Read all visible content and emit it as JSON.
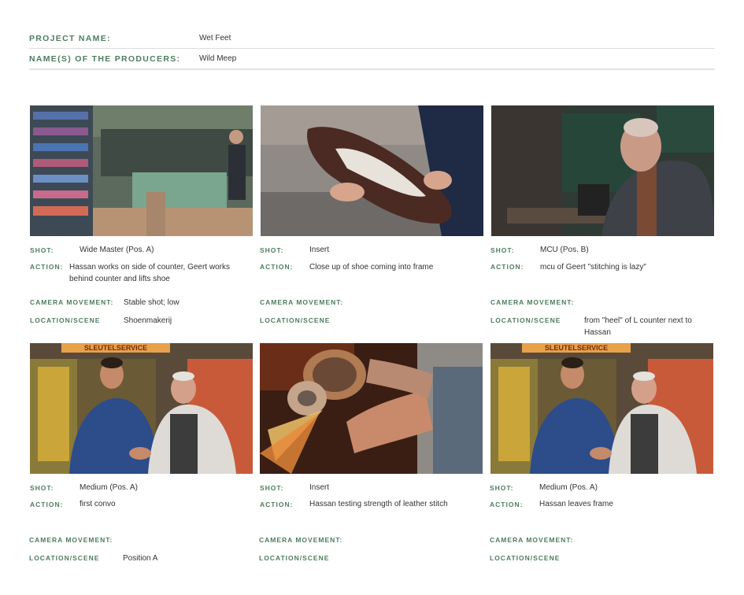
{
  "header": {
    "project_label": "PROJECT NAME:",
    "project_value": "Wet Feet",
    "producers_label": "NAME(S) OF THE PRODUCERS:",
    "producers_value": "Wild Meep"
  },
  "field_labels": {
    "shot": "SHOT:",
    "action": "ACTION:",
    "camera": "CAMERA MOVEMENT:",
    "location": "LOCATION/SCENE"
  },
  "shots": [
    {
      "image": "shoe-shop-interior-photo",
      "shot": "Wide Master (Pos. A)",
      "action": "Hassan works on side of counter, Geert works behind counter and lifts shoe",
      "camera": "Stable shot; low",
      "location": "Shoenmakerij"
    },
    {
      "image": "hand-holding-brogue-shoe-photo",
      "shot": "Insert",
      "action": "Close up of shoe coming into frame",
      "camera": "",
      "location": ""
    },
    {
      "image": "man-stitching-shoe-photo",
      "shot": "MCU (Pos. B)",
      "action": "mcu of Geert \"stitching is lazy\"",
      "camera": "",
      "location": "from \"heel\" of L counter next to Hassan"
    },
    {
      "image": "two-men-handshake-photo",
      "shot": "Medium (Pos. A)",
      "action": "first convo",
      "camera": "",
      "location": "Position A"
    },
    {
      "image": "grinding-wheel-sparks-photo",
      "shot": "Insert",
      "action": "Hassan testing strength of leather stitch",
      "camera": "",
      "location": ""
    },
    {
      "image": "two-men-handshake-photo",
      "shot": "Medium (Pos. A)",
      "action": "Hassan leaves frame",
      "camera": "",
      "location": ""
    }
  ],
  "sign_text": "SLEUTELSERVICE"
}
